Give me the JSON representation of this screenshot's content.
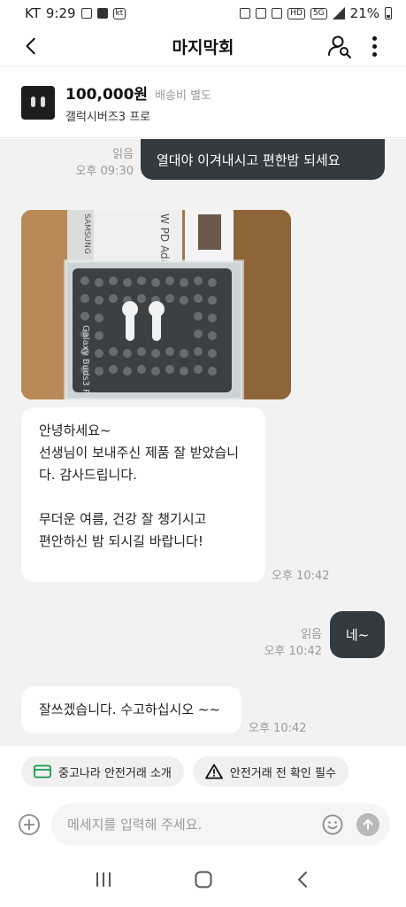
{
  "status_bar": {
    "carrier": "KT",
    "time": "9:29",
    "kt_badge": "kt",
    "network": "5G",
    "battery": "21%"
  },
  "header": {
    "title": "마지막회"
  },
  "product": {
    "price": "100,000원",
    "shipping": "배송비 별도",
    "name": "갤럭시버즈3 프로"
  },
  "messages": [
    {
      "dir": "out",
      "text": "열대야 이겨내시고 편한밤 되세요",
      "read": "읽음",
      "time": "오후 09:30"
    },
    {
      "dir": "in",
      "type": "image",
      "photo_text": {
        "box_brand": "SAMSUNG",
        "box_label": "W PD Adapter",
        "pkg_text": "Galaxy Buds3 Pro"
      }
    },
    {
      "dir": "in",
      "lines": [
        "안녕하세요~",
        "선생님이 보내주신 제품 잘 받았습니",
        "다.  감사드립니다.",
        "",
        "무더운 여름, 건강 잘 챙기시고",
        "편안하신 밤 되시길 바랍니다!"
      ],
      "time": "오후 10:42"
    },
    {
      "dir": "out",
      "text": "네~",
      "read": "읽음",
      "time": "오후 10:42"
    },
    {
      "dir": "in",
      "text": "잘쓰겠습니다.  수고하십시오 ~~",
      "time": "오후 10:42"
    }
  ],
  "chips": [
    {
      "label": "중고나라 안전거래 소개",
      "icon": "card-icon"
    },
    {
      "label": "안전거래 전 확인 필수",
      "icon": "warning-icon"
    }
  ],
  "composer": {
    "placeholder": "메세지를 입력해 주세요."
  },
  "colors": {
    "out_bubble": "#333b41",
    "chat_bg": "#f2f2f2",
    "accent": "#111111"
  }
}
